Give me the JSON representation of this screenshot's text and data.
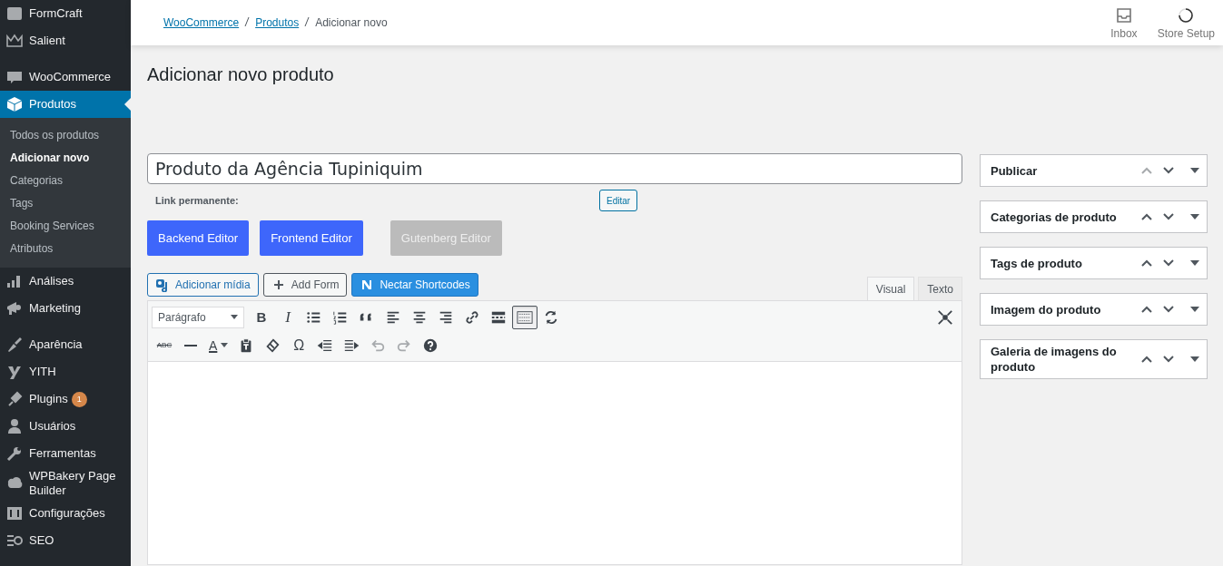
{
  "sidebar": {
    "groups": [
      {
        "items": [
          {
            "label": "FormCraft",
            "selected": false
          },
          {
            "label": "Salient",
            "selected": false
          }
        ]
      },
      {
        "items": [
          {
            "label": "WooCommerce",
            "selected": false
          },
          {
            "label": "Produtos",
            "selected": true,
            "children": [
              {
                "label": "Todos os produtos",
                "selected": false
              },
              {
                "label": "Adicionar novo",
                "selected": true
              },
              {
                "label": "Categorias",
                "selected": false
              },
              {
                "label": "Tags",
                "selected": false
              },
              {
                "label": "Booking Services",
                "selected": false
              },
              {
                "label": "Atributos",
                "selected": false
              }
            ]
          },
          {
            "label": "Análises",
            "selected": false
          },
          {
            "label": "Marketing",
            "selected": false
          }
        ]
      },
      {
        "items": [
          {
            "label": "Aparência",
            "selected": false
          },
          {
            "label": "YITH",
            "selected": false
          },
          {
            "label": "Plugins",
            "selected": false,
            "badge": "1"
          },
          {
            "label": "Usuários",
            "selected": false
          },
          {
            "label": "Ferramentas",
            "selected": false
          },
          {
            "label": "WPBakery Page Builder",
            "selected": false
          },
          {
            "label": "Configurações",
            "selected": false
          },
          {
            "label": "SEO",
            "selected": false
          }
        ]
      }
    ]
  },
  "header": {
    "breadcrumbs": [
      {
        "label": "WooCommerce",
        "link": true
      },
      {
        "label": "Produtos",
        "link": true
      },
      {
        "label": "Adicionar novo",
        "link": false
      }
    ],
    "actions": [
      {
        "label": "Inbox"
      },
      {
        "label": "Store Setup"
      }
    ]
  },
  "page_title": "Adicionar novo produto",
  "title_field": {
    "value": "Produto da Agência Tupiniquim"
  },
  "permalink": {
    "label": "Link permanente:",
    "button": "Editar"
  },
  "editor_buttons": [
    {
      "label": "Backend Editor",
      "disabled": false
    },
    {
      "label": "Frontend Editor",
      "disabled": false
    },
    {
      "label": "Gutenberg Editor",
      "disabled": true
    }
  ],
  "media_buttons": [
    {
      "label": "Adicionar mídia",
      "kind": "outline"
    },
    {
      "label": "Add Form",
      "kind": "outline"
    },
    {
      "label": "Nectar Shortcodes",
      "kind": "primary"
    }
  ],
  "editor_tabs": [
    {
      "label": "Visual",
      "selected": true
    },
    {
      "label": "Texto",
      "selected": false
    }
  ],
  "toolbar": {
    "rows": [
      {
        "items": [
          {
            "kind": "select",
            "label": "Parágrafo",
            "active": false,
            "disabled": false
          },
          {
            "kind": "bold",
            "label": "B",
            "active": false,
            "disabled": false
          },
          {
            "kind": "italic",
            "label": "I",
            "active": false,
            "disabled": false
          },
          {
            "kind": "icon",
            "active": false,
            "disabled": false
          },
          {
            "kind": "icon",
            "active": false,
            "disabled": false
          },
          {
            "kind": "icon",
            "active": false,
            "disabled": false
          },
          {
            "kind": "icon",
            "active": false,
            "disabled": false
          },
          {
            "kind": "icon",
            "active": false,
            "disabled": false
          },
          {
            "kind": "icon",
            "active": false,
            "disabled": false
          },
          {
            "kind": "icon",
            "active": false,
            "disabled": false
          },
          {
            "kind": "icon",
            "active": false,
            "disabled": false
          },
          {
            "kind": "icon",
            "active": true,
            "disabled": false
          },
          {
            "kind": "icon",
            "active": false,
            "disabled": false
          }
        ]
      },
      {
        "items": [
          {
            "kind": "strike",
            "label": "ABC",
            "active": false,
            "disabled": false
          },
          {
            "kind": "icon",
            "active": false,
            "disabled": false
          },
          {
            "kind": "color",
            "label": "A",
            "active": false,
            "disabled": false
          },
          {
            "kind": "icon",
            "active": false,
            "disabled": false
          },
          {
            "kind": "icon",
            "active": false,
            "disabled": false
          },
          {
            "kind": "char",
            "label": "Ω",
            "active": false,
            "disabled": false
          },
          {
            "kind": "icon",
            "active": false,
            "disabled": false
          },
          {
            "kind": "icon",
            "active": false,
            "disabled": false
          },
          {
            "kind": "icon",
            "active": false,
            "disabled": true
          },
          {
            "kind": "icon",
            "active": false,
            "disabled": true
          },
          {
            "kind": "icon",
            "active": false,
            "disabled": false
          }
        ]
      }
    ]
  },
  "side_boxes": [
    {
      "title": "Publicar",
      "up_disabled": true
    },
    {
      "title": "Categorias de produto",
      "up_disabled": false
    },
    {
      "title": "Tags de produto",
      "up_disabled": false
    },
    {
      "title": "Imagem do produto",
      "up_disabled": false
    },
    {
      "title": "Galeria de imagens do produto",
      "up_disabled": false
    }
  ]
}
